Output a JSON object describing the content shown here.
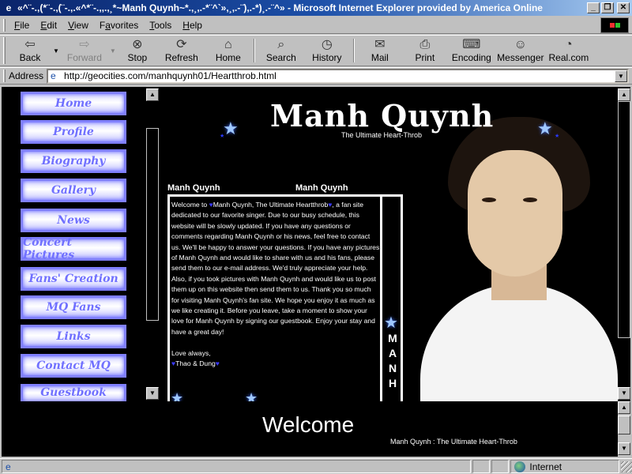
{
  "window": {
    "title": "«^¨-.,(*¨-.,(¨-.,.«^*¨-.,,.,¸*~Manh Quynh~*.,¸,.-*¨^`»,¸,.-¨),.-*)¸.-¨^» - Microsoft Internet Explorer provided by America Online",
    "minimize": "_",
    "maximize": "❐",
    "close": "✕"
  },
  "menu": {
    "items": [
      {
        "pre": "",
        "key": "F",
        "post": "ile"
      },
      {
        "pre": "",
        "key": "E",
        "post": "dit"
      },
      {
        "pre": "",
        "key": "V",
        "post": "iew"
      },
      {
        "pre": "F",
        "key": "a",
        "post": "vorites"
      },
      {
        "pre": "",
        "key": "T",
        "post": "ools"
      },
      {
        "pre": "",
        "key": "H",
        "post": "elp"
      }
    ]
  },
  "toolbar": {
    "back": "Back",
    "forward": "Forward",
    "stop": "Stop",
    "refresh": "Refresh",
    "home": "Home",
    "search": "Search",
    "history": "History",
    "mail": "Mail",
    "print": "Print",
    "encoding": "Encoding",
    "messenger": "Messenger",
    "realcom": "Real.com"
  },
  "address": {
    "label": "Address",
    "url": "http://geocities.com/manhquynh01/Heartthrob.html"
  },
  "nav": {
    "items": [
      "Home",
      "Profile",
      "Biography",
      "Gallery",
      "News",
      "Concert Pictures",
      "Fans' Creation",
      "MQ Fans",
      "Links",
      "Contact MQ",
      "Guestbook"
    ]
  },
  "main": {
    "site_title": "Manh Quynh",
    "site_subtitle": "The Ultimate Heart-Throb",
    "name_left": "Manh Quynh",
    "name_right": "Manh Quynh",
    "intro_pre": "Welcome to ",
    "intro_name": "Manh Quynh, The Ultimate Heartthrob",
    "intro_body": ", a fan site dedicated to our favorite singer. Due to our busy schedule, this website will be slowly updated. If you have any questions or comments regarding Manh Quynh or his news, feel free to contact us. We'll be happy to answer your questions. If you have any pictures of Manh Quynh and would like to share with us and his fans, please send them to our e-mail address. We'd truly appreciate your help. Also, if you took pictures with Manh Quynh and would like us to post them up on this website then send them to us. Thank you so much for visiting Manh Quynh's fan site. We hope you enjoy it as much as we like creating it. Before you leave, take a moment to show your love for Manh Quynh by signing our guestbook. Enjoy your stay and have a great day!",
    "signoff": "Love always,",
    "signature": "Thao & Dung",
    "vertical_letters": [
      "M",
      "A",
      "N",
      "H"
    ]
  },
  "bottom": {
    "welcome": "Welcome",
    "caption": "Manh Quynh : The Ultimate Heart-Throb"
  },
  "status": {
    "zone": "Internet"
  },
  "icons": {
    "heart": "♥",
    "star": "★"
  },
  "colors": {
    "titlebar": "#0a246a",
    "nav_text": "#7070ff",
    "nav_border": "#8080ff",
    "page_bg": "#000000"
  }
}
